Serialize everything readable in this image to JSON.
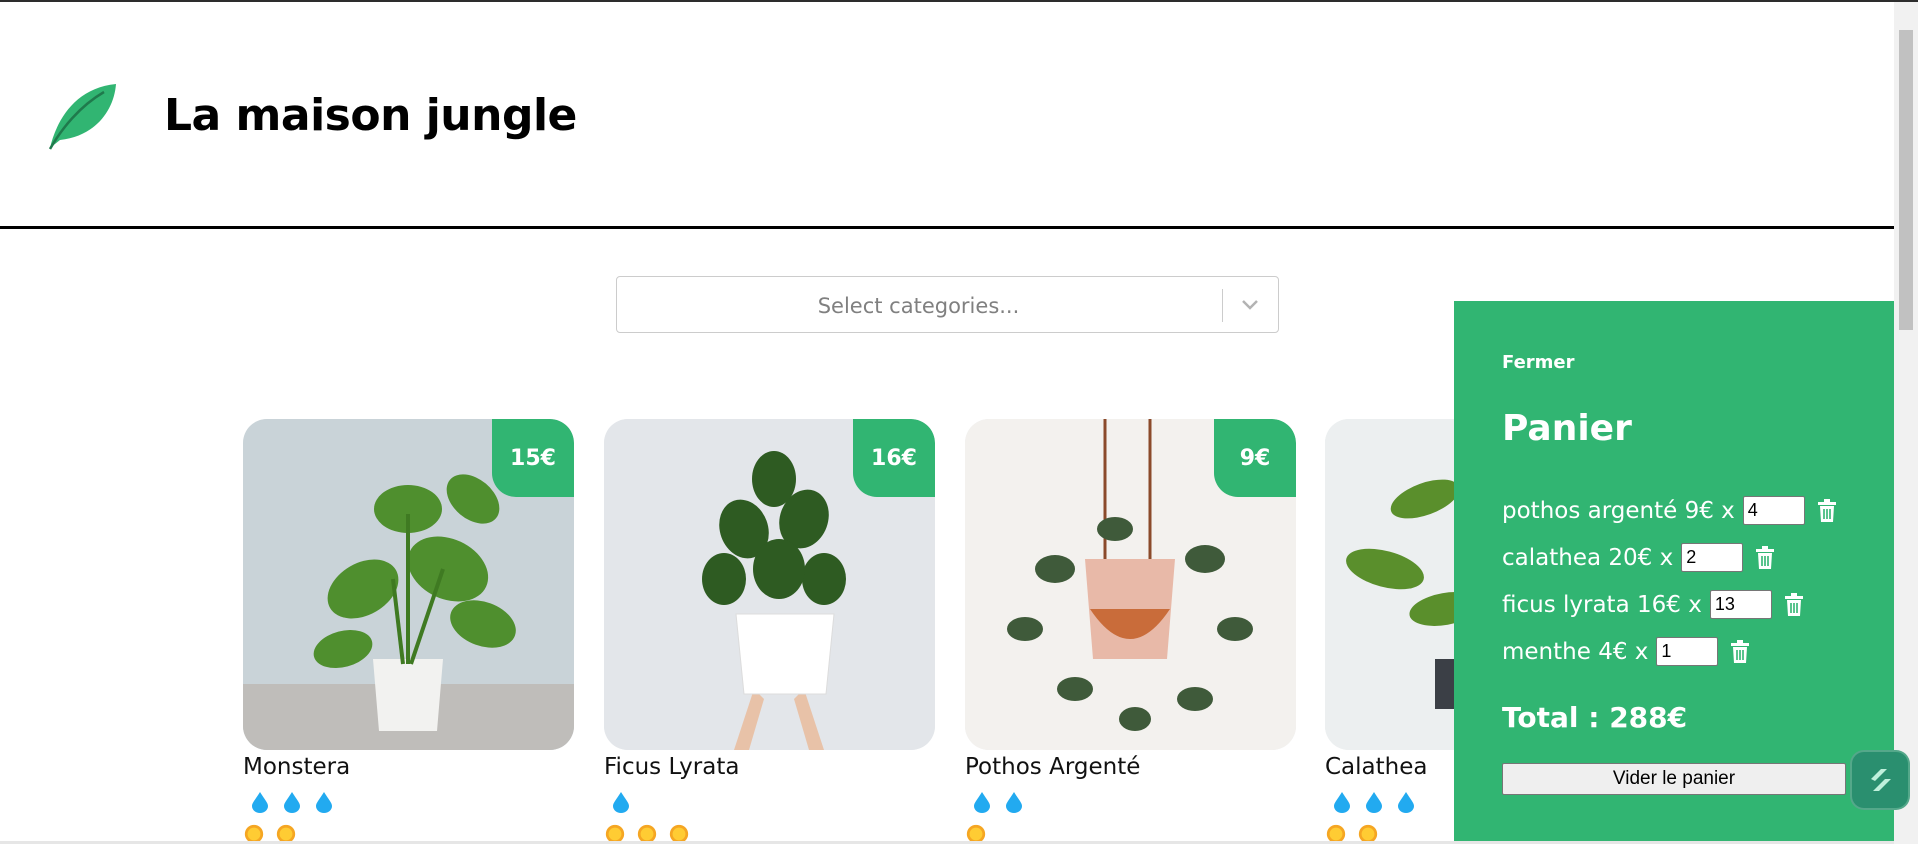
{
  "header": {
    "title": "La maison jungle"
  },
  "filter": {
    "placeholder": "Select categories..."
  },
  "products": [
    {
      "name": "Monstera",
      "price": "15€",
      "water": 3,
      "light": 2
    },
    {
      "name": "Ficus Lyrata",
      "price": "16€",
      "water": 1,
      "light": 3
    },
    {
      "name": "Pothos Argenté",
      "price": "9€",
      "water": 2,
      "light": 1
    },
    {
      "name": "Calathea",
      "price": "",
      "water": 3,
      "light": 2
    }
  ],
  "cart": {
    "close_label": "Fermer",
    "title": "Panier",
    "items": [
      {
        "label": "pothos argenté 9€ x",
        "quantity": "4"
      },
      {
        "label": "calathea 20€ x",
        "quantity": "2"
      },
      {
        "label": "ficus lyrata 16€ x",
        "quantity": "13"
      },
      {
        "label": "menthe 4€ x",
        "quantity": "1"
      }
    ],
    "total": "Total : 288€",
    "empty_button": "Vider le panier"
  },
  "colors": {
    "accent": "#31b572"
  },
  "icons": {
    "logo": "leaf-icon",
    "water": "water-drop-icon",
    "light": "sun-icon",
    "delete": "trash-icon",
    "dropdown": "chevron-down-icon"
  }
}
